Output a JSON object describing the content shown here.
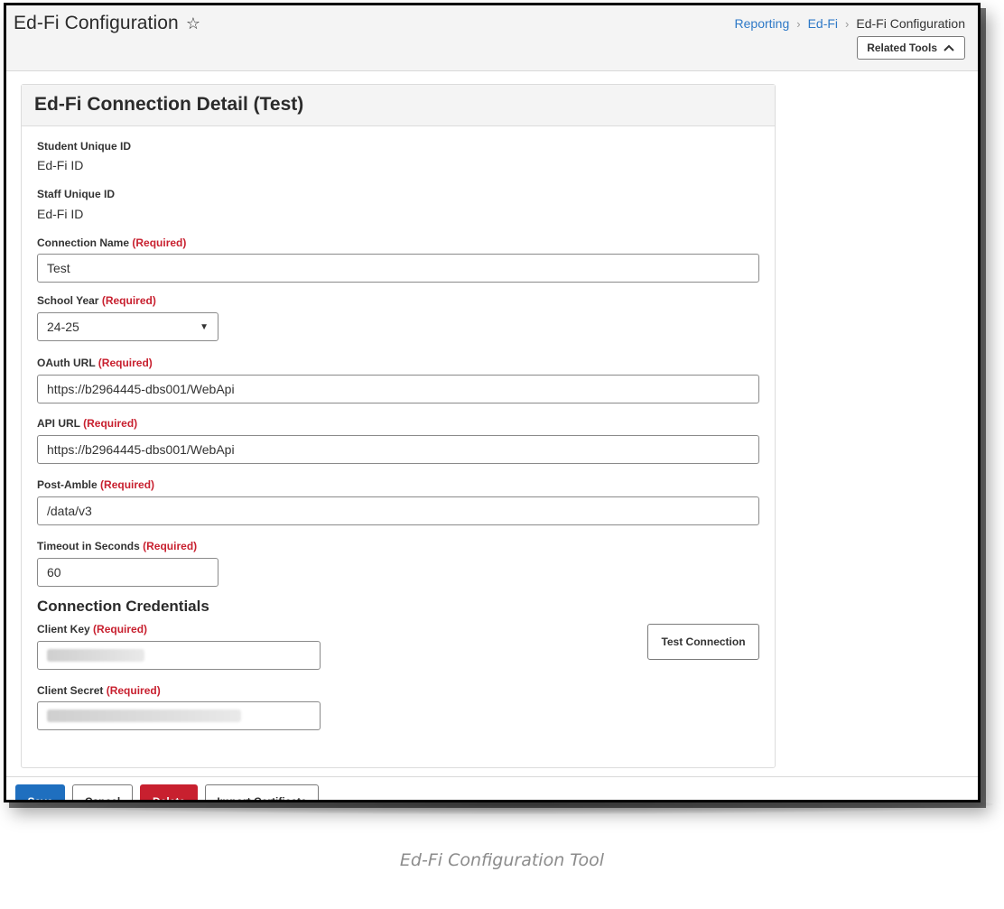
{
  "header": {
    "title": "Ed-Fi Configuration",
    "breadcrumb": {
      "item1": "Reporting",
      "item2": "Ed-Fi",
      "current": "Ed-Fi Configuration"
    },
    "related_tools_label": "Related Tools"
  },
  "panel": {
    "title": "Ed-Fi Connection Detail (Test)",
    "student_unique_id": {
      "label": "Student Unique ID",
      "value": "Ed-Fi ID"
    },
    "staff_unique_id": {
      "label": "Staff Unique ID",
      "value": "Ed-Fi ID"
    },
    "required_tag": "(Required)",
    "connection_name": {
      "label": "Connection Name",
      "value": "Test"
    },
    "school_year": {
      "label": "School Year",
      "value": "24-25"
    },
    "oauth_url": {
      "label": "OAuth URL",
      "value": "https://b2964445-dbs001/WebApi"
    },
    "api_url": {
      "label": "API URL",
      "value": "https://b2964445-dbs001/WebApi"
    },
    "post_amble": {
      "label": "Post-Amble",
      "value": "/data/v3"
    },
    "timeout": {
      "label": "Timeout in Seconds",
      "value": "60"
    },
    "credentials_title": "Connection Credentials",
    "client_key": {
      "label": "Client Key"
    },
    "client_secret": {
      "label": "Client Secret"
    },
    "test_connection_label": "Test Connection"
  },
  "footer": {
    "save_label": "Save",
    "cancel_label": "Cancel",
    "delete_label": "Delete",
    "import_label": "Import Certificate"
  },
  "caption": "Ed-Fi Configuration Tool",
  "colors": {
    "link": "#2e79c7",
    "required": "#c8202f",
    "primary": "#1f6fbf",
    "danger": "#c8202f"
  },
  "icons": {
    "favorite": "star-icon",
    "related_tools": "chevron-up-icon",
    "select": "caret-down-icon"
  }
}
